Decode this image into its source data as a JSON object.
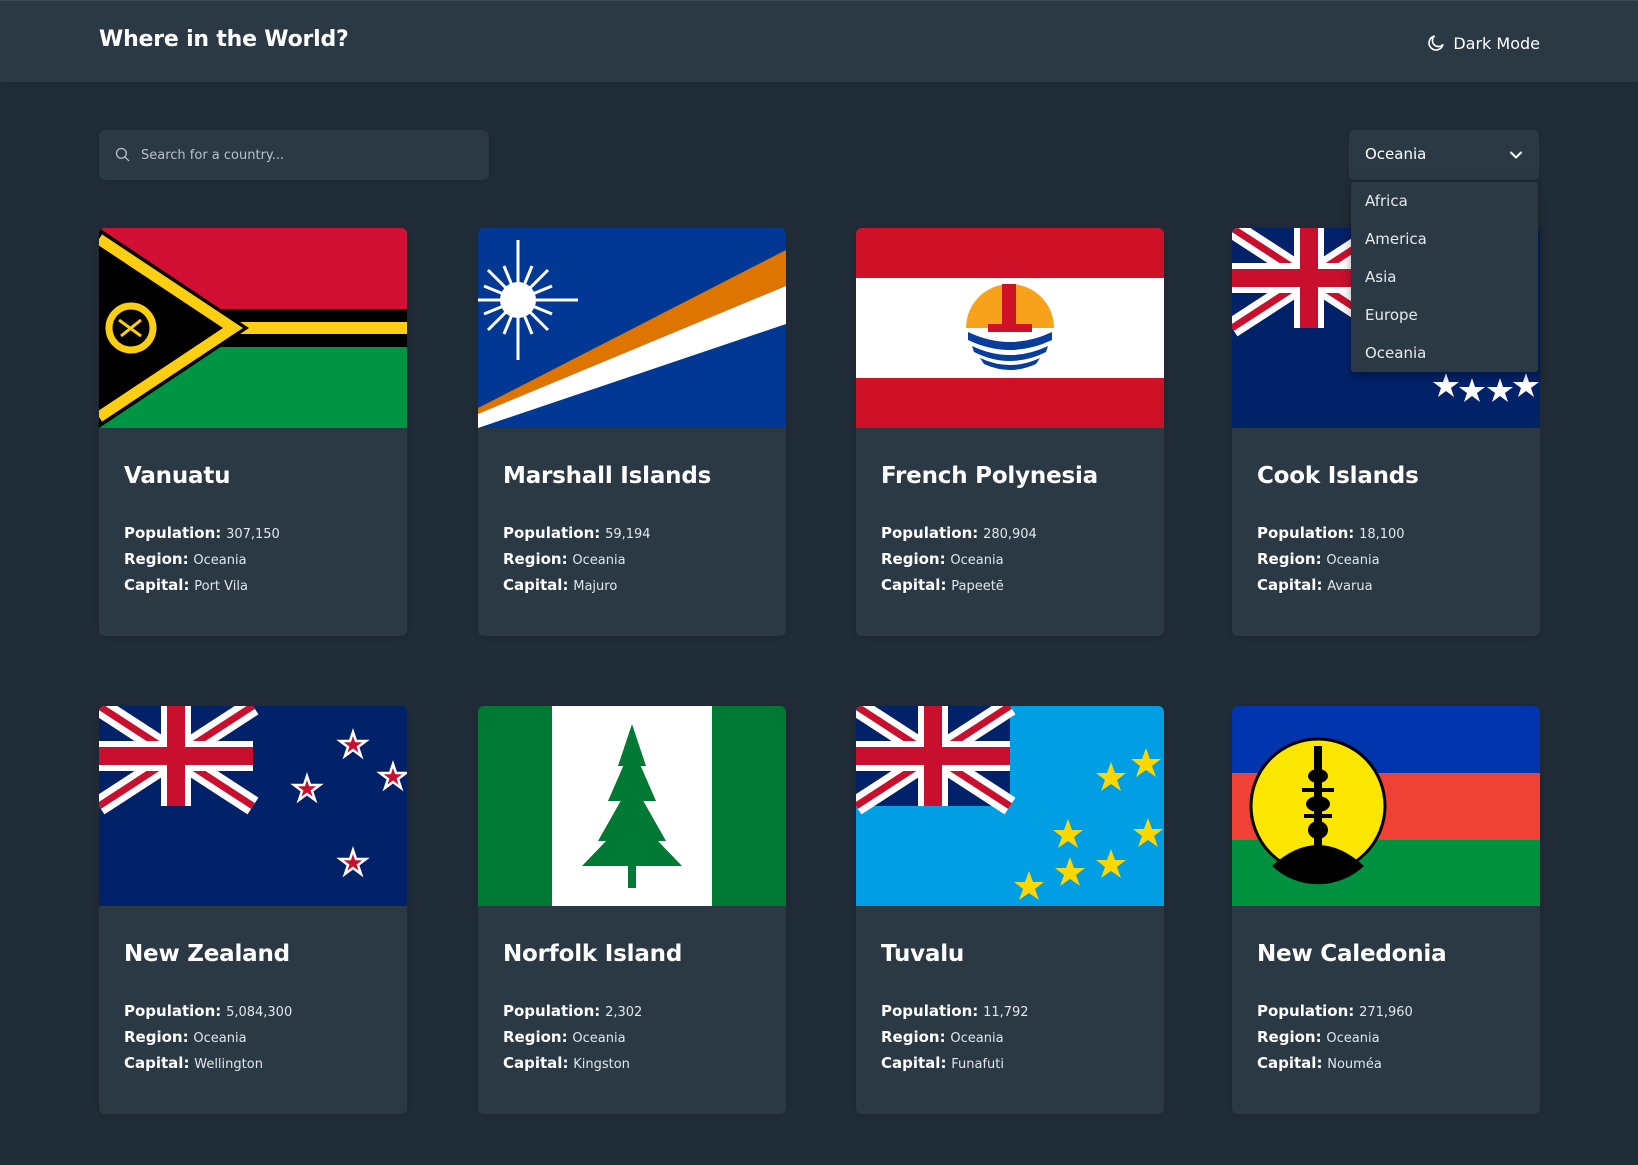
{
  "header": {
    "title": "Where in the World?",
    "theme_toggle_label": "Dark Mode",
    "theme_icon": "moon-icon"
  },
  "search": {
    "placeholder": "Search for a country...",
    "value": "",
    "icon": "search-icon"
  },
  "filter": {
    "selected": "Oceania",
    "options": [
      "Africa",
      "America",
      "Asia",
      "Europe",
      "Oceania"
    ]
  },
  "labels": {
    "population": "Population:",
    "region": "Region:",
    "capital": "Capital:"
  },
  "countries": [
    {
      "name": "Vanuatu",
      "population": "307,150",
      "region": "Oceania",
      "capital": "Port Vila",
      "flag": "vanuatu-flag"
    },
    {
      "name": "Marshall Islands",
      "population": "59,194",
      "region": "Oceania",
      "capital": "Majuro",
      "flag": "marshall-islands-flag"
    },
    {
      "name": "French Polynesia",
      "population": "280,904",
      "region": "Oceania",
      "capital": "Papeetē",
      "flag": "french-polynesia-flag"
    },
    {
      "name": "Cook Islands",
      "population": "18,100",
      "region": "Oceania",
      "capital": "Avarua",
      "flag": "cook-islands-flag"
    },
    {
      "name": "New Zealand",
      "population": "5,084,300",
      "region": "Oceania",
      "capital": "Wellington",
      "flag": "new-zealand-flag"
    },
    {
      "name": "Norfolk Island",
      "population": "2,302",
      "region": "Oceania",
      "capital": "Kingston",
      "flag": "norfolk-island-flag"
    },
    {
      "name": "Tuvalu",
      "population": "11,792",
      "region": "Oceania",
      "capital": "Funafuti",
      "flag": "tuvalu-flag"
    },
    {
      "name": "New Caledonia",
      "population": "271,960",
      "region": "Oceania",
      "capital": "Nouméa",
      "flag": "new-caledonia-flag"
    }
  ],
  "colors": {
    "background": "#202c37",
    "surface": "#2b3945",
    "text": "#ffffff"
  }
}
